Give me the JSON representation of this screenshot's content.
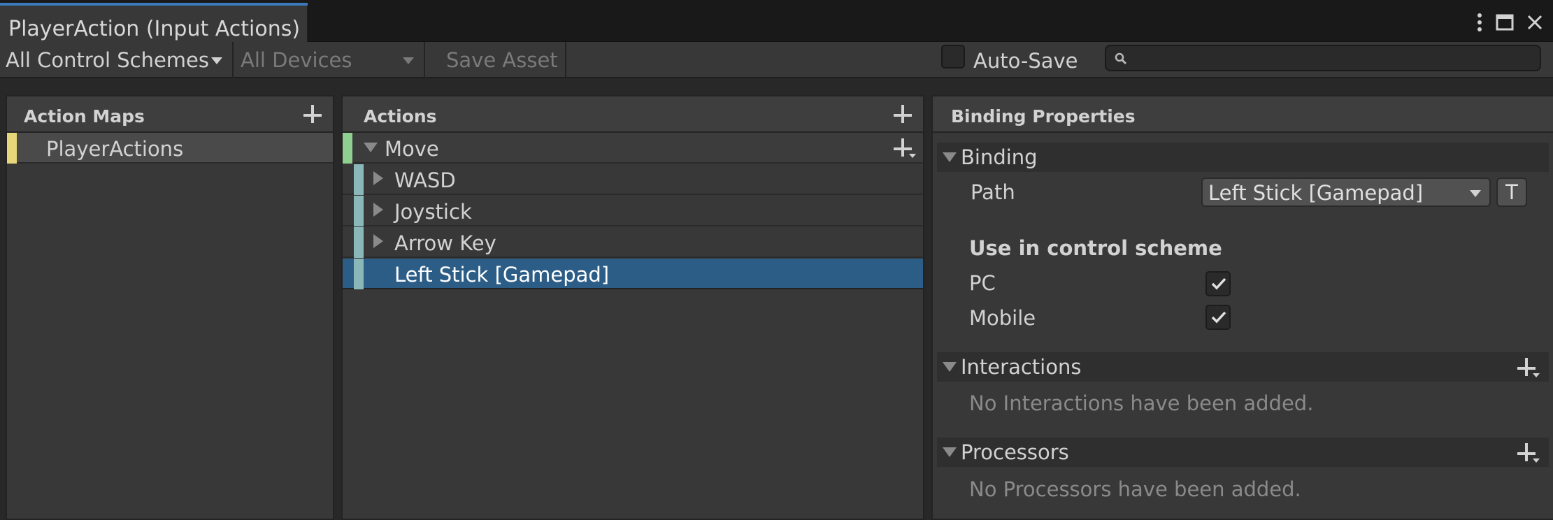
{
  "window": {
    "tab_title": "PlayerAction (Input Actions)"
  },
  "toolbar": {
    "control_schemes": "All Control Schemes",
    "devices": "All Devices",
    "save_asset": "Save Asset",
    "auto_save_label": "Auto-Save",
    "auto_save_checked": false,
    "search_value": ""
  },
  "action_maps": {
    "title": "Action Maps",
    "items": [
      {
        "label": "PlayerActions",
        "selected": true,
        "color": "#e8d77a"
      }
    ]
  },
  "actions": {
    "title": "Actions",
    "action": {
      "label": "Move",
      "expanded": true,
      "color": "#8fcf8f"
    },
    "bindings": [
      {
        "label": "WASD",
        "composite": true
      },
      {
        "label": "Joystick",
        "composite": true
      },
      {
        "label": "Arrow Key",
        "composite": true
      },
      {
        "label": "Left Stick [Gamepad]",
        "composite": false,
        "selected": true
      }
    ],
    "binding_color": "#8ab8b8",
    "selected_color": "#2c5d87"
  },
  "properties": {
    "title": "Binding Properties",
    "binding_section": "Binding",
    "path_label": "Path",
    "path_value": "Left Stick [Gamepad]",
    "t_button": "T",
    "control_scheme_heading": "Use in control scheme",
    "schemes": [
      {
        "label": "PC",
        "checked": true
      },
      {
        "label": "Mobile",
        "checked": true
      }
    ],
    "interactions_section": "Interactions",
    "interactions_empty": "No Interactions have been added.",
    "processors_section": "Processors",
    "processors_empty": "No Processors have been added."
  }
}
